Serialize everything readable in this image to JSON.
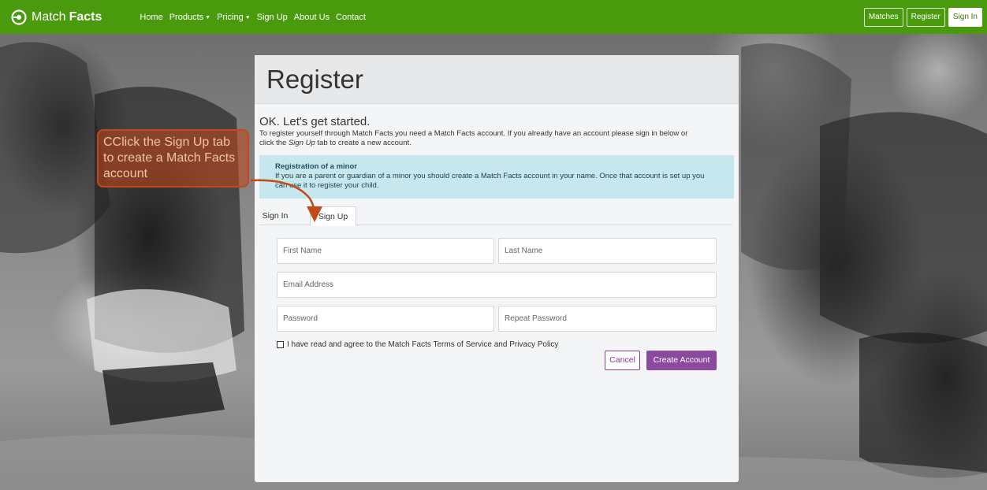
{
  "navbar": {
    "brand_match": "Match",
    "brand_facts": "Facts",
    "links": [
      {
        "label": "Home"
      },
      {
        "label": "Products"
      },
      {
        "label": "Pricing"
      },
      {
        "label": "Sign Up"
      },
      {
        "label": "About Us"
      },
      {
        "label": "Contact"
      }
    ],
    "caret": "▼",
    "buttons": {
      "matches": "Matches",
      "register": "Register",
      "sign_in": "Sign In"
    }
  },
  "card": {
    "title": "Register",
    "intro_heading": "OK. Let's get started.",
    "intro_line1": "To register yourself through Match Facts you need a Match Facts account. If you already have an account please sign in below or",
    "intro_line2_before": "click the ",
    "intro_line2_em": "Sign Up",
    "intro_line2_after": " tab to create a new account.",
    "alert_title": "Registration of a minor",
    "alert_text": "If you are a parent or guardian of a minor you should create a Match Facts account in your name. Once that account is set up you can use it to register your child.",
    "tabs": {
      "sign_in": "Sign In",
      "sign_up": "Sign Up",
      "active": "Sign Up"
    },
    "form": {
      "first_name_placeholder": "First Name",
      "last_name_placeholder": "Last Name",
      "email_placeholder": "Email Address",
      "password_placeholder": "Password",
      "repeat_password_placeholder": "Repeat Password",
      "terms_label": "I have read and agree to the Match Facts Terms of Service and Privacy Policy",
      "terms_checked": false,
      "cancel_label": "Cancel",
      "create_label": "Create Account"
    }
  },
  "callout": {
    "text": "CClick the Sign Up tab to create a Match Facts account",
    "color": "#c24a18"
  },
  "colors": {
    "navbar": "#4a9a0e",
    "accent_purple": "#8b4a9e",
    "alert_bg": "#c7e7ee"
  }
}
